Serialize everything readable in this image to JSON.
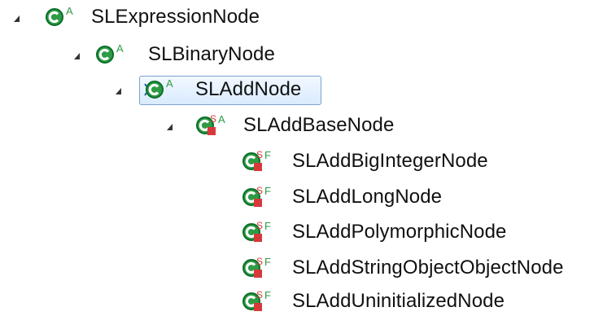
{
  "tree": {
    "items": [
      {
        "label": "SLExpressionNode",
        "badge": "A",
        "icon": "class-abstract-icon",
        "expanded": true
      },
      {
        "label": "SLBinaryNode",
        "badge": "A",
        "icon": "class-abstract-icon",
        "expanded": true
      },
      {
        "label": "SLAddNode",
        "badge": "A",
        "icon": "class-abstract-icon",
        "expanded": true,
        "selected": true
      },
      {
        "label": "SLAddBaseNode",
        "badge": "S A",
        "icon": "static-abstract-class-icon",
        "expanded": true
      },
      {
        "label": "SLAddBigIntegerNode",
        "badge": "S F",
        "icon": "static-final-class-icon",
        "expanded": false
      },
      {
        "label": "SLAddLongNode",
        "badge": "S F",
        "icon": "static-final-class-icon",
        "expanded": false
      },
      {
        "label": "SLAddPolymorphicNode",
        "badge": "S F",
        "icon": "static-final-class-icon",
        "expanded": false
      },
      {
        "label": "SLAddStringObjectObjectNode",
        "badge": "S F",
        "icon": "static-final-class-icon",
        "expanded": false
      },
      {
        "label": "SLAddUninitializedNode",
        "badge": "S F",
        "icon": "static-final-class-icon",
        "expanded": false
      }
    ]
  },
  "colors": {
    "class_green": "#2f9b45",
    "class_dark_green": "#0b6f2a",
    "static_red": "#d7393b",
    "selected_border": "#7da2ce",
    "selected_fill": "#d9ebff",
    "text": "#111111"
  }
}
